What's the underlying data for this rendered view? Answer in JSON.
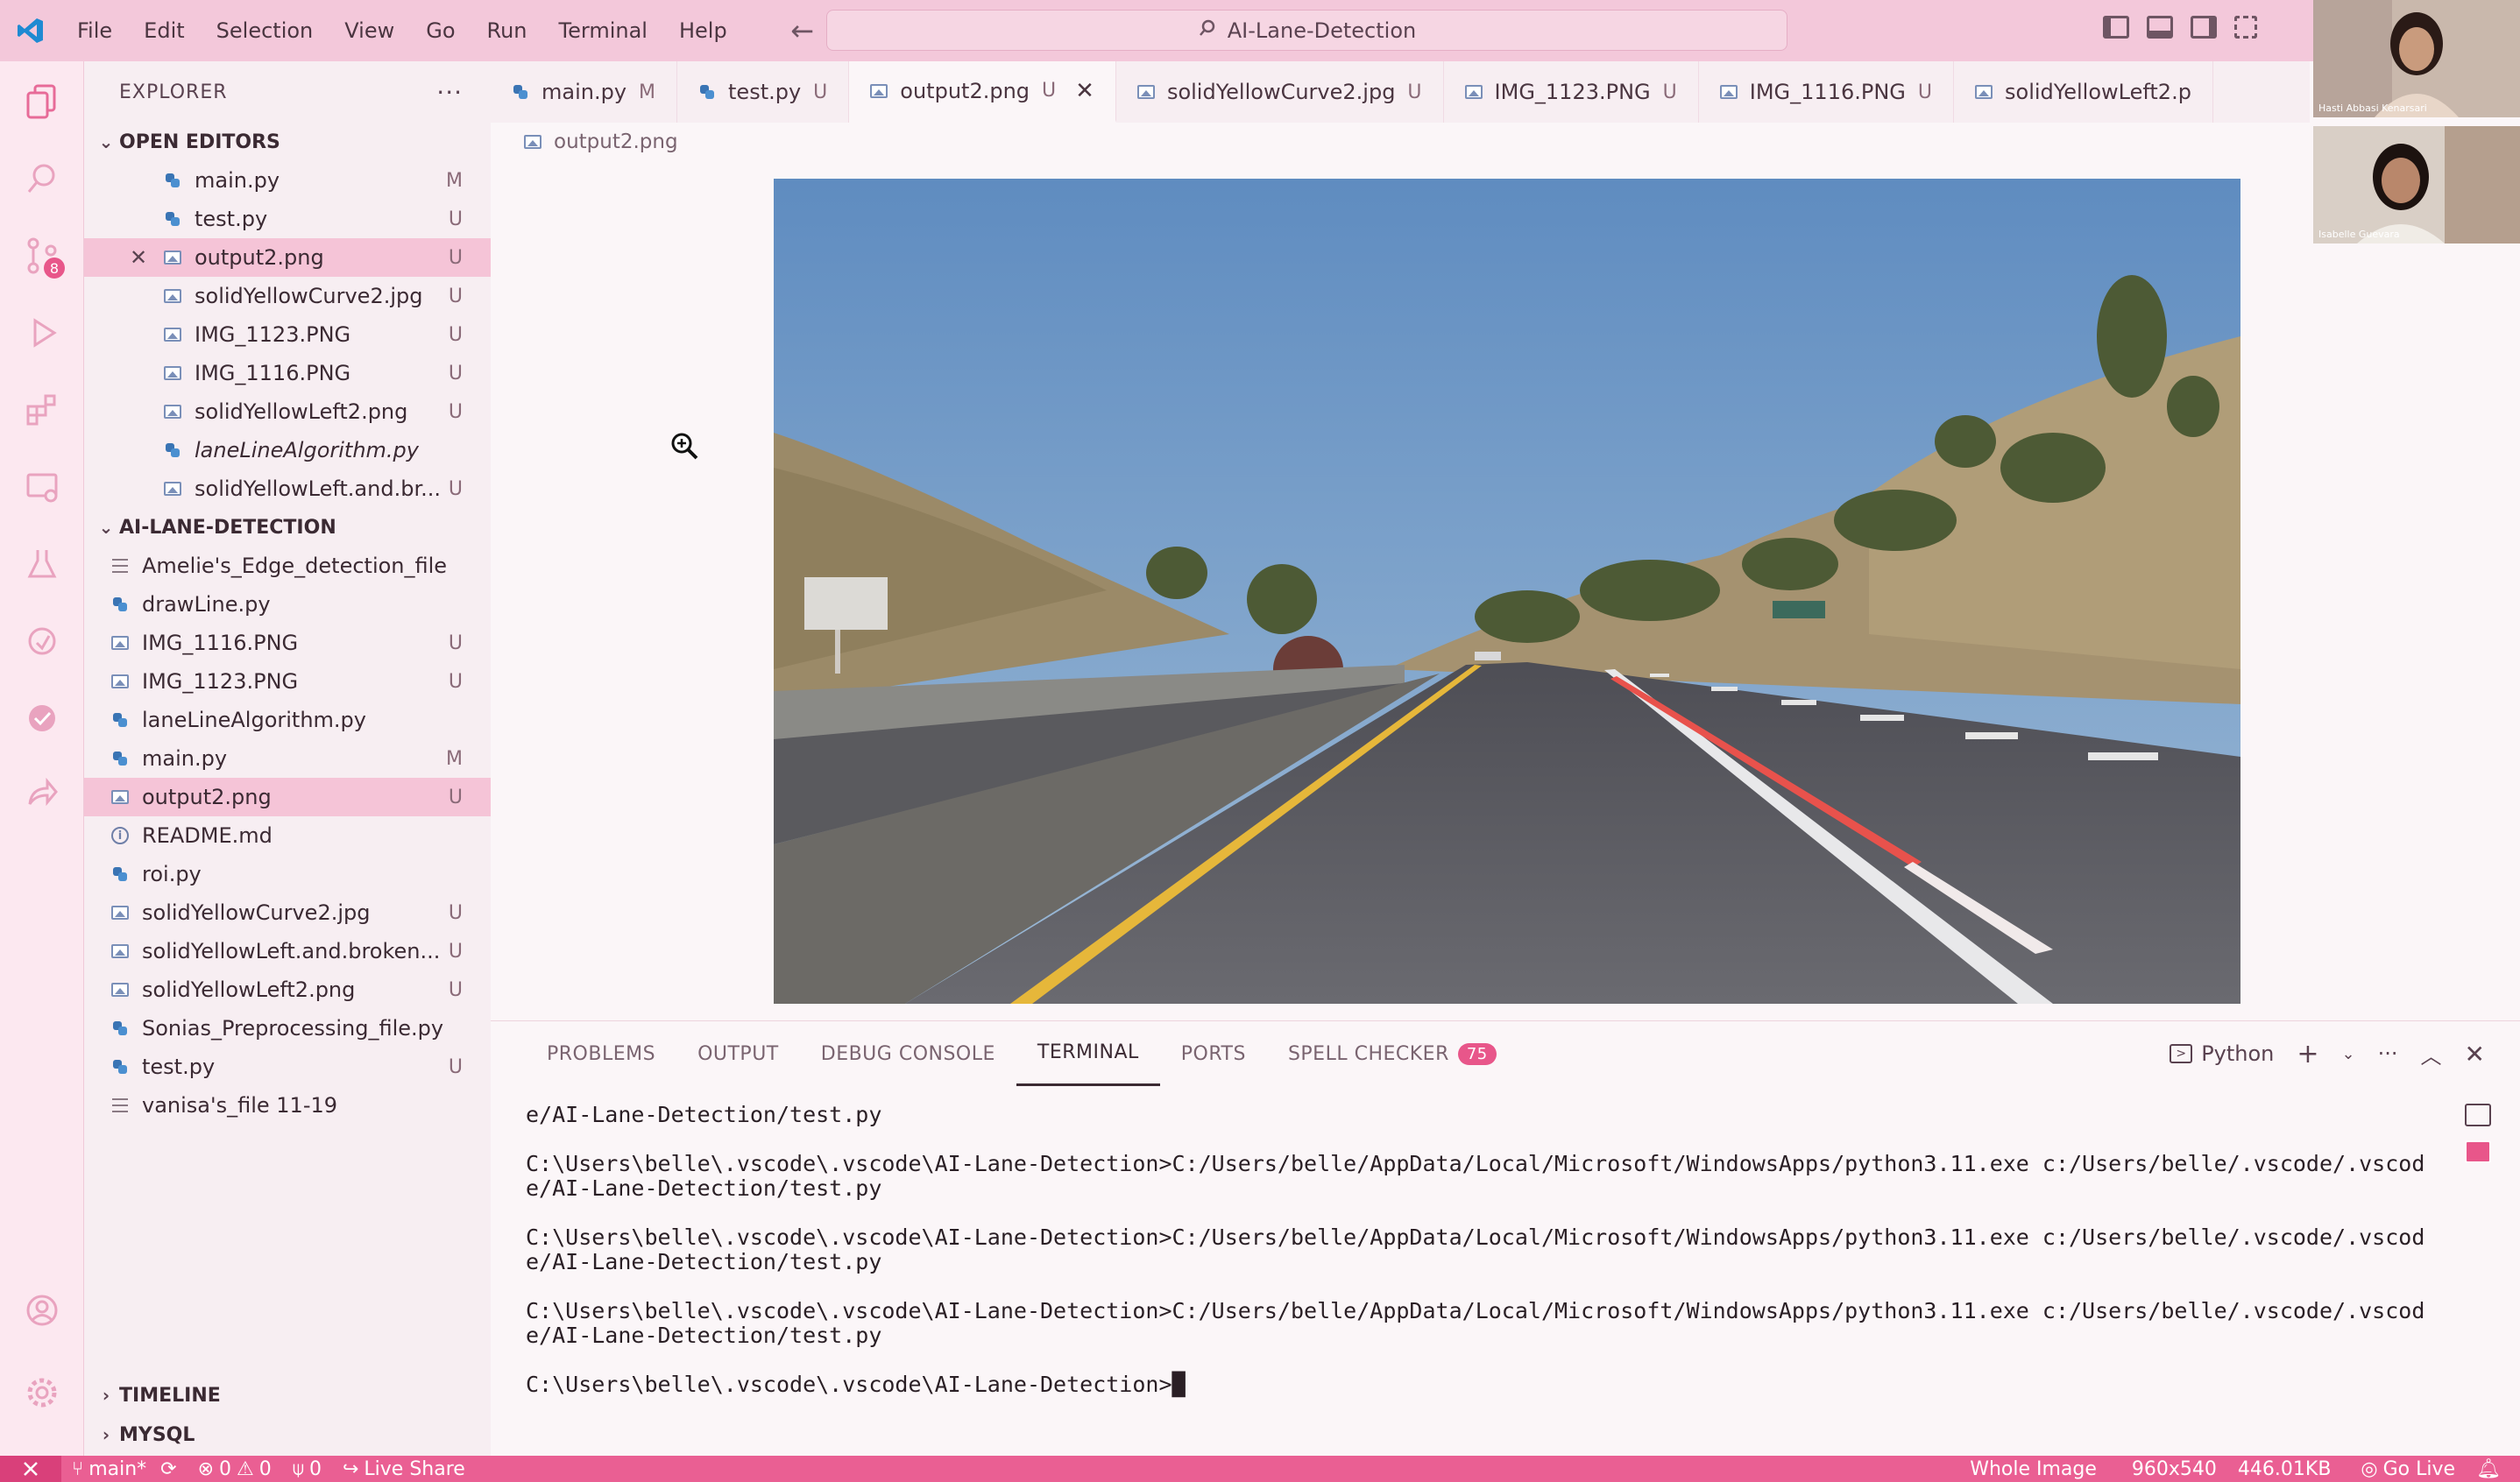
{
  "titlebar": {
    "menu": [
      "File",
      "Edit",
      "Selection",
      "View",
      "Go",
      "Run",
      "Terminal",
      "Help"
    ],
    "search_text": "AI-Lane-Detection"
  },
  "video_call": [
    {
      "name": "Hasti Abbasi Kenarsari"
    },
    {
      "name": "Isabelle Guevara"
    }
  ],
  "activity_bar": {
    "scm_badge": "8"
  },
  "sidebar": {
    "title": "EXPLORER",
    "more": "···",
    "open_editors_label": "OPEN EDITORS",
    "open_editors": [
      {
        "name": "main.py",
        "status": "M",
        "type": "py"
      },
      {
        "name": "test.py",
        "status": "U",
        "type": "py"
      },
      {
        "name": "output2.png",
        "status": "U",
        "type": "img",
        "selected": true
      },
      {
        "name": "solidYellowCurve2.jpg",
        "status": "U",
        "type": "img"
      },
      {
        "name": "IMG_1123.PNG",
        "status": "U",
        "type": "img"
      },
      {
        "name": "IMG_1116.PNG",
        "status": "U",
        "type": "img"
      },
      {
        "name": "solidYellowLeft2.png",
        "status": "U",
        "type": "img"
      },
      {
        "name": "laneLineAlgorithm.py",
        "status": "",
        "type": "py"
      },
      {
        "name": "solidYellowLeft.and.br...",
        "status": "U",
        "type": "img"
      }
    ],
    "project_label": "AI-LANE-DETECTION",
    "project_files": [
      {
        "name": "Amelie's_Edge_detection_file",
        "status": "",
        "type": "txt"
      },
      {
        "name": "drawLine.py",
        "status": "",
        "type": "py"
      },
      {
        "name": "IMG_1116.PNG",
        "status": "U",
        "type": "img"
      },
      {
        "name": "IMG_1123.PNG",
        "status": "U",
        "type": "img"
      },
      {
        "name": "laneLineAlgorithm.py",
        "status": "",
        "type": "py"
      },
      {
        "name": "main.py",
        "status": "M",
        "type": "py"
      },
      {
        "name": "output2.png",
        "status": "U",
        "type": "img",
        "selected": true
      },
      {
        "name": "README.md",
        "status": "",
        "type": "info"
      },
      {
        "name": "roi.py",
        "status": "",
        "type": "py"
      },
      {
        "name": "solidYellowCurve2.jpg",
        "status": "U",
        "type": "img"
      },
      {
        "name": "solidYellowLeft.and.broken...",
        "status": "U",
        "type": "img"
      },
      {
        "name": "solidYellowLeft2.png",
        "status": "U",
        "type": "img"
      },
      {
        "name": "Sonias_Preprocessing_file.py",
        "status": "",
        "type": "py"
      },
      {
        "name": "test.py",
        "status": "U",
        "type": "py"
      },
      {
        "name": "vanisa's_file 11-19",
        "status": "",
        "type": "txt"
      }
    ],
    "timeline_label": "TIMELINE",
    "mysql_label": "MYSQL"
  },
  "tabs": [
    {
      "name": "main.py",
      "status": "M",
      "type": "py"
    },
    {
      "name": "test.py",
      "status": "U",
      "type": "py"
    },
    {
      "name": "output2.png",
      "status": "U",
      "type": "img",
      "active": true
    },
    {
      "name": "solidYellowCurve2.jpg",
      "status": "U",
      "type": "img"
    },
    {
      "name": "IMG_1123.PNG",
      "status": "U",
      "type": "img"
    },
    {
      "name": "IMG_1116.PNG",
      "status": "U",
      "type": "img"
    },
    {
      "name": "solidYellowLeft2.p",
      "status": "",
      "type": "img"
    }
  ],
  "breadcrumb": "output2.png",
  "panel": {
    "tabs": [
      "PROBLEMS",
      "OUTPUT",
      "DEBUG CONSOLE",
      "TERMINAL",
      "PORTS",
      "SPELL CHECKER"
    ],
    "active_tab": "TERMINAL",
    "spell_count": "75",
    "shell": "Python",
    "terminal_lines": [
      "e/AI-Lane-Detection/test.py",
      "",
      "C:\\Users\\belle\\.vscode\\.vscode\\AI-Lane-Detection>C:/Users/belle/AppData/Local/Microsoft/WindowsApps/python3.11.exe c:/Users/belle/.vscode/.vscod",
      "e/AI-Lane-Detection/test.py",
      "",
      "C:\\Users\\belle\\.vscode\\.vscode\\AI-Lane-Detection>C:/Users/belle/AppData/Local/Microsoft/WindowsApps/python3.11.exe c:/Users/belle/.vscode/.vscod",
      "e/AI-Lane-Detection/test.py",
      "",
      "C:\\Users\\belle\\.vscode\\.vscode\\AI-Lane-Detection>C:/Users/belle/AppData/Local/Microsoft/WindowsApps/python3.11.exe c:/Users/belle/.vscode/.vscod",
      "e/AI-Lane-Detection/test.py",
      "",
      "C:\\Users\\belle\\.vscode\\.vscode\\AI-Lane-Detection>█"
    ]
  },
  "statusbar": {
    "branch": "main*",
    "errors": "0",
    "warnings": "0",
    "ports": "0",
    "live_share": "Live Share",
    "whole_image": "Whole Image",
    "dimensions": "960x540",
    "size": "446.01KB",
    "go_live": "Go Live"
  },
  "colors": {
    "titlebar": "#f3c8da",
    "accent": "#ea5f93",
    "selection": "#f5c4d7"
  }
}
